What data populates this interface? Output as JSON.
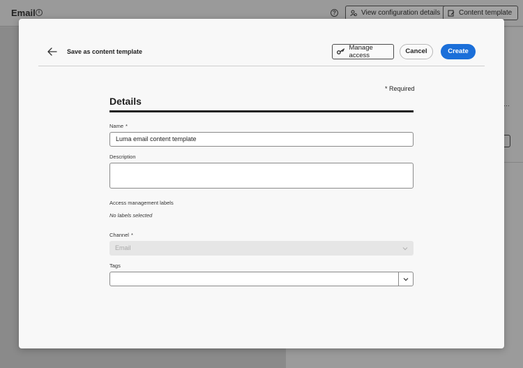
{
  "background": {
    "title": "Email",
    "view_config_label": "View configuration details",
    "content_template_label": "Content template"
  },
  "modal": {
    "title": "Save as content template",
    "manage_access_label": "Manage access",
    "cancel_label": "Cancel",
    "create_label": "Create",
    "required_note": "* Required",
    "section_title": "Details",
    "name": {
      "label": "Name",
      "value": "Luma email content template"
    },
    "description": {
      "label": "Description",
      "value": ""
    },
    "access_labels": {
      "label": "Access management labels",
      "empty_text": "No labels selected"
    },
    "channel": {
      "label": "Channel",
      "value": "Email"
    },
    "tags": {
      "label": "Tags",
      "value": ""
    },
    "required_mark": "*"
  },
  "colors": {
    "accent": "#1b6fd9",
    "overlay": "#8e8e8e"
  }
}
